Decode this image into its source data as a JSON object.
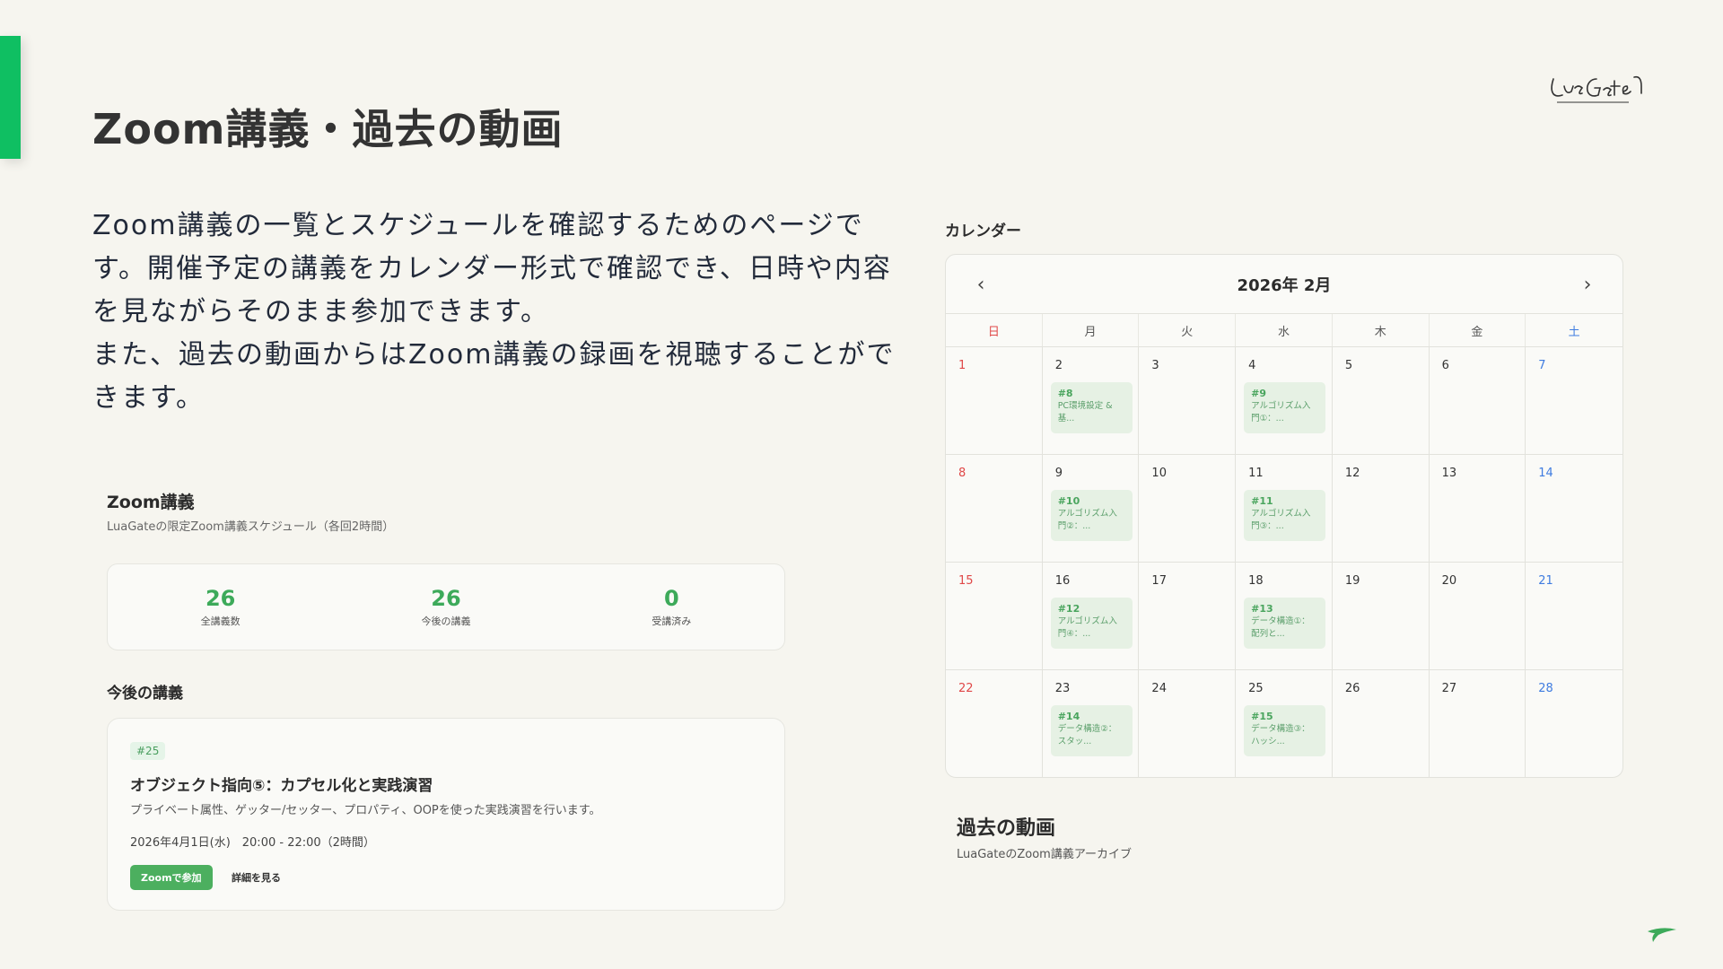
{
  "brand": {
    "name": "LuaGate",
    "accent": "#0fbf62"
  },
  "page": {
    "title": "Zoom講義・過去の動画",
    "intro": [
      "Zoom講義の一覧とスケジュールを確認するためのページです。開催予定の講義をカレンダー形式で確認でき、日時や内容を見ながらそのまま参加できます。",
      "また、過去の動画からはZoom講義の録画を視聴することができます。"
    ]
  },
  "zoom": {
    "title": "Zoom講義",
    "subtitle": "LuaGateの限定Zoom講義スケジュール（各回2時間）",
    "stats": [
      {
        "value": "26",
        "label": "全講義数"
      },
      {
        "value": "26",
        "label": "今後の講義"
      },
      {
        "value": "0",
        "label": "受講済み"
      }
    ]
  },
  "upcoming": {
    "title": "今後の講義",
    "lecture": {
      "badge": "#25",
      "title": "オブジェクト指向⑤：カプセル化と実践演習",
      "description": "プライベート属性、ゲッター/セッター、プロパティ、OOPを使った実践演習を行います。",
      "datetime": "2026年4月1日(水)　20:00 - 22:00（2時間）",
      "join_label": "Zoomで参加",
      "detail_label": "詳細を見る"
    }
  },
  "calendar": {
    "label": "カレンダー",
    "month": "2026年 2月",
    "prev_icon": "‹",
    "next_icon": "›",
    "weekdays": [
      "日",
      "月",
      "火",
      "水",
      "木",
      "金",
      "土"
    ],
    "days": [
      {
        "n": "1"
      },
      {
        "n": "2",
        "event": {
          "num": "#8",
          "title": "PC環境設定 & 基..."
        }
      },
      {
        "n": "3"
      },
      {
        "n": "4",
        "event": {
          "num": "#9",
          "title": "アルゴリズム入門①：..."
        }
      },
      {
        "n": "5"
      },
      {
        "n": "6"
      },
      {
        "n": "7"
      },
      {
        "n": "8"
      },
      {
        "n": "9",
        "event": {
          "num": "#10",
          "title": "アルゴリズム入門②：..."
        }
      },
      {
        "n": "10"
      },
      {
        "n": "11",
        "event": {
          "num": "#11",
          "title": "アルゴリズム入門③：..."
        }
      },
      {
        "n": "12"
      },
      {
        "n": "13"
      },
      {
        "n": "14"
      },
      {
        "n": "15"
      },
      {
        "n": "16",
        "event": {
          "num": "#12",
          "title": "アルゴリズム入門④：..."
        }
      },
      {
        "n": "17"
      },
      {
        "n": "18",
        "event": {
          "num": "#13",
          "title": "データ構造①：配列と..."
        }
      },
      {
        "n": "19"
      },
      {
        "n": "20"
      },
      {
        "n": "21"
      },
      {
        "n": "22"
      },
      {
        "n": "23",
        "event": {
          "num": "#14",
          "title": "データ構造②：スタッ..."
        }
      },
      {
        "n": "24"
      },
      {
        "n": "25",
        "event": {
          "num": "#15",
          "title": "データ構造③：ハッシ..."
        }
      },
      {
        "n": "26"
      },
      {
        "n": "27"
      },
      {
        "n": "28"
      }
    ]
  },
  "past": {
    "title": "過去の動画",
    "subtitle": "LuaGateのZoom講義アーカイブ"
  }
}
